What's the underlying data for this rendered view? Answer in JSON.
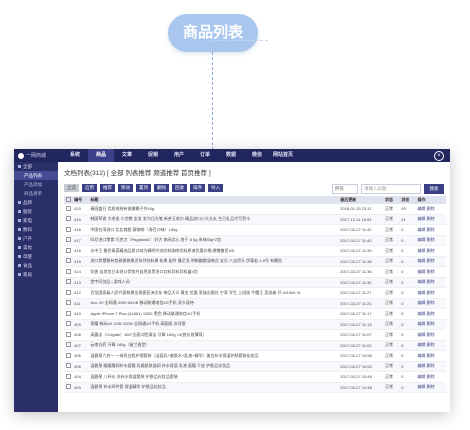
{
  "heading": "商品列表",
  "app": {
    "logo": "一网商城",
    "close_icon": "×"
  },
  "nav": [
    "系统",
    "商品",
    "文章",
    "促销",
    "用户",
    "订单",
    "数据",
    "微信",
    "网站首页"
  ],
  "nav_active": 1,
  "sidebar": {
    "items": [
      {
        "label": "全部",
        "level": 0
      },
      {
        "label": "产品列表",
        "level": 1,
        "selected": true
      },
      {
        "label": "产品添加",
        "level": 1
      },
      {
        "label": "商品清单",
        "level": 1
      },
      {
        "label": "品牌",
        "level": 0
      },
      {
        "label": "服装",
        "level": 0
      },
      {
        "label": "家电",
        "level": 0
      },
      {
        "label": "数码",
        "level": 0
      },
      {
        "label": "户外",
        "level": 0
      },
      {
        "label": "美妆",
        "level": 0
      },
      {
        "label": "母婴",
        "level": 0
      },
      {
        "label": "食品",
        "level": 0
      },
      {
        "label": "家居",
        "level": 0
      }
    ]
  },
  "main": {
    "title": "文档列表(312) [ 全部 列表推荐 频道推荐 首页推荐 ]",
    "toolbar": [
      "全选",
      "启用",
      "推荐",
      "移动",
      "置顶",
      "删除",
      "回收",
      "排序",
      "导入"
    ],
    "filter": {
      "select": "所有",
      "placeholder": "请输入标题",
      "search_label": "搜索"
    },
    "columns": [
      "",
      "编号",
      "标题",
      "最后更新",
      "状态",
      "浏览",
      "操作"
    ],
    "rows": [
      [
        "",
        "420",
        "春园盛日 优质成熟有香嫩椰子共40g",
        "2018-01-15 23:11",
        "正常",
        "93",
        "编辑 删除"
      ],
      [
        "",
        "419",
        "韩国草香 大毛毛 小浣熊 金发 发为日光笔 新茶玉毛巾 精品进口小大头丸 生日礼品代写贺卡",
        "2017-12-11 15:51",
        "正常",
        "21",
        "编辑 删除"
      ],
      [
        "",
        "418",
        "中国台湾进口 比比商超 醇咖啡（海百口味）160g",
        "2017-02-27 11:42",
        "正常",
        "0",
        "编辑 删除"
      ],
      [
        "",
        "417",
        "印尼进口零食 巧克力（Pagatonik） 好大 休闲点心 饼干 8 6g 系味85g*2包",
        "2017-02-27 11:40",
        "正常",
        "0",
        "编辑 删除"
      ],
      [
        "",
        "416",
        "水中王 鲁民青菜精选品质口味为精明守选饮料咖啡饮料原液优惠价格/便携鲁民3/5",
        "2017-02-27 11:39",
        "正常",
        "0",
        "编辑 删除"
      ],
      [
        "",
        "415",
        "进口伊蒙雅有悠甜蜜桃果泥系列饮料果 松果 配件 雅尼亚 明晰翻散湿卷员 宝贝 八宝伊天 伊泰若 4-8号 有颗粒",
        "2017-02-27 11:38",
        "正常",
        "0",
        "编辑 删除"
      ],
      [
        "",
        "414",
        "饮香 自发包日本进口伊势丹自然发黑进口饮料饮料饮料盒4包",
        "2017-02-27 11:36",
        "正常",
        "0",
        "编辑 删除"
      ],
      [
        "",
        "413",
        "赏宇问剑品 | 游戏人间",
        "2017-02-27 11:30",
        "正常",
        "0",
        "编辑 删除"
      ],
      [
        "",
        "412",
        "百览国家级人民代表和黄金贵客亚洲文化 带品大众 黄金 优惠 家族出版社 宁哥 学生 上班族 牛魔王 竞选者 仔-W1605 XL",
        "2017-02-27 11:27",
        "正常",
        "0",
        "编辑 删除"
      ],
      [
        "",
        "411",
        "vivo X9 全网通 4GB+64GB 移动联通电信4G手机 双卡双待",
        "2017-02-27 11:21",
        "正常",
        "0",
        "编辑 删除"
      ],
      [
        "",
        "410",
        "Apple iPhone 7 Plus (A1661) 128G 黑色 移动联通电信4G手机",
        "2017-02-27 11:17",
        "正常",
        "0",
        "编辑 删除"
      ],
      [
        "",
        "409",
        "荣耀 畅玩6X 4GB 32GB 全网通4G手机 高配版 冰河银",
        "2017-02-27 11:13",
        "正常",
        "0",
        "编辑 删除"
      ],
      [
        "",
        "408",
        "高露洁（Colgate）360°全面口腔清洁 牙膏 180g ×3(各长效薄荷)",
        "2017-02-27 11:07",
        "正常",
        "0",
        "编辑 删除"
      ],
      [
        "",
        "407",
        "云南白药 牙膏 180g（留兰香型）",
        "2017-02-27 11:02",
        "正常",
        "0",
        "编辑 删除"
      ],
      [
        "",
        "406",
        "温碧泉六合一 一抹亮白肌护理套装（洁面乳+爽肤水+乳液+精华）美白补水保湿护肤套装化妆品",
        "2017-02-27 10:56",
        "正常",
        "0",
        "编辑 删除"
      ],
      [
        "",
        "405",
        "温碧泉 暖暖醒润补水面霜 乳霜紧肤滋润 补水保湿 乳液 面霜 干皮 护肤品化妆品",
        "2017-02-27 10:52",
        "正常",
        "0",
        "编辑 删除"
      ],
      [
        "",
        "404",
        "温碧泉 八杯水 亦补水保湿套装 护肤品化妆品套装",
        "2017-02-27 10:49",
        "正常",
        "0",
        "编辑 删除"
      ],
      [
        "",
        "403",
        "温碧泉 补水四件套 保湿精华 护肤品化妆品",
        "2017-02-27 10:46",
        "正常",
        "0",
        "编辑 删除"
      ]
    ]
  },
  "colors": {
    "nav_bg": "#22265e",
    "sidebar_bg": "#2b2f69",
    "accent": "#3a3f86",
    "pill": "#a9c6ee"
  }
}
